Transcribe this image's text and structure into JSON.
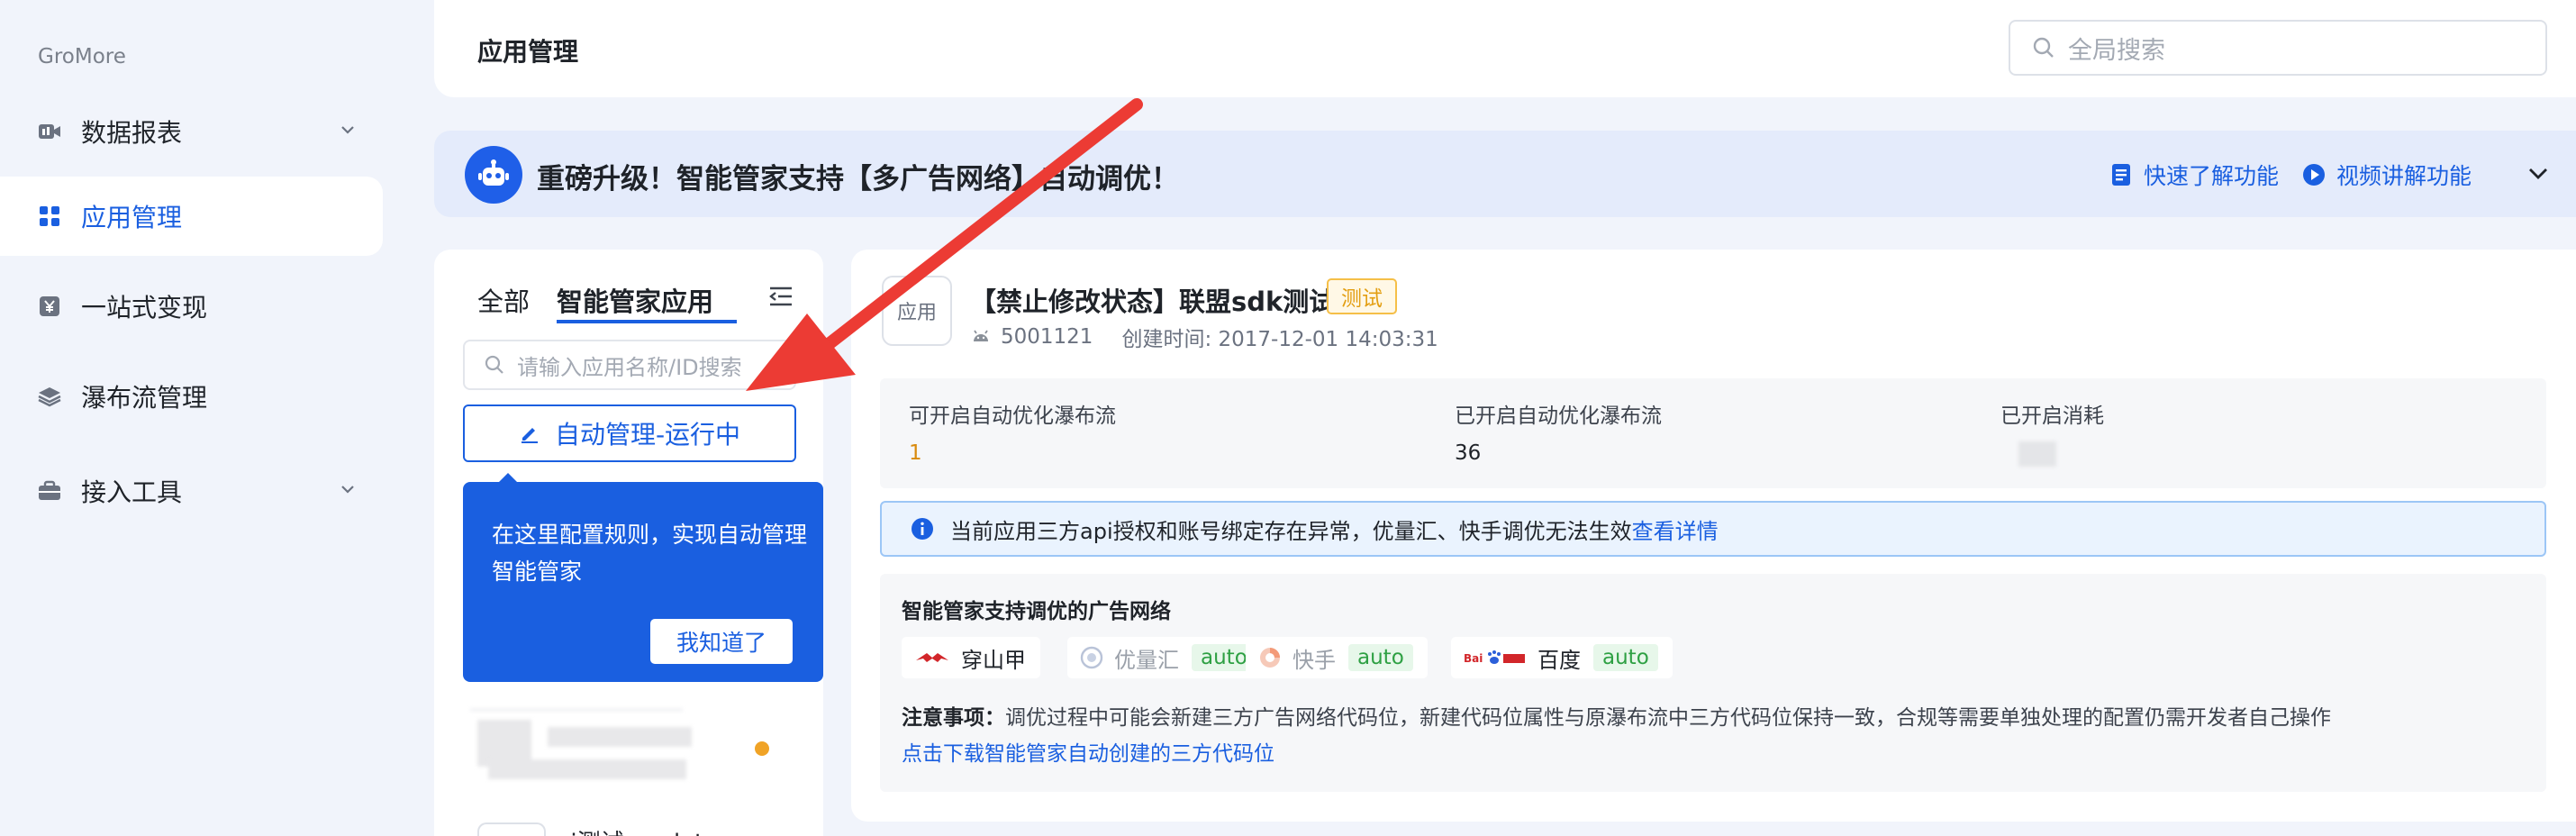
{
  "sidebar": {
    "brand": "GroMore",
    "items": [
      {
        "label": "数据报表",
        "icon": "video-chart-icon",
        "expandable": true,
        "active": false
      },
      {
        "label": "应用管理",
        "icon": "grid-apps-icon",
        "expandable": false,
        "active": true
      },
      {
        "label": "一站式变现",
        "icon": "yen-icon",
        "expandable": false,
        "active": false
      },
      {
        "label": "瀑布流管理",
        "icon": "layers-icon",
        "expandable": false,
        "active": false
      },
      {
        "label": "接入工具",
        "icon": "toolbox-icon",
        "expandable": true,
        "active": false
      }
    ]
  },
  "header": {
    "title": "应用管理",
    "search_placeholder": "全局搜索"
  },
  "banner": {
    "text": "重磅升级！智能管家支持【多广告网络】自动调优！",
    "link_quick": "快速了解功能",
    "link_video": "视频讲解功能"
  },
  "app_list": {
    "tabs": [
      "全部",
      "智能管家应用"
    ],
    "active_tab": 1,
    "search_placeholder": "请输入应用名称/ID搜索",
    "auto_button": "自动管理-运行中",
    "tooltip_text": "在这里配置规则，实现自动管理智能管家",
    "tooltip_button": "我知道了",
    "partial_item": "xi测试_update"
  },
  "detail": {
    "icon_label": "应用",
    "app_name": "【禁止修改状态】联盟sdk测试",
    "tag": "测试",
    "app_id": "5001121",
    "created": "创建时间: 2017-12-01 14:03:31",
    "stats": [
      {
        "label": "可开启自动优化瀑布流",
        "value": "1"
      },
      {
        "label": "已开启自动优化瀑布流",
        "value": "36"
      },
      {
        "label": "已开启消耗",
        "value": ""
      }
    ],
    "alert_text": "当前应用三方api授权和账号绑定存在异常，优量汇、快手调优无法生效",
    "alert_link": "查看详情",
    "networks_title": "智能管家支持调优的广告网络",
    "networks": [
      {
        "name": "穿山甲",
        "auto": "",
        "enabled": true
      },
      {
        "name": "优量汇",
        "auto": "auto",
        "enabled": false
      },
      {
        "name": "快手",
        "auto": "auto",
        "enabled": false
      },
      {
        "name": "百度",
        "auto": "auto",
        "enabled": true
      }
    ],
    "note_label": "注意事项：",
    "note_text": "调优过程中可能会新建三方广告网络代码位，新建代码位属性与原瀑布流中三方代码位保持一致，合规等需要单独处理的配置仍需开发者自己操作",
    "download_link": "点击下载智能管家自动创建的三方代码位"
  },
  "colors": {
    "primary": "#1a5fe0",
    "arrow": "#ec3b34",
    "warning": "#f0a326",
    "success": "#2ea043"
  }
}
